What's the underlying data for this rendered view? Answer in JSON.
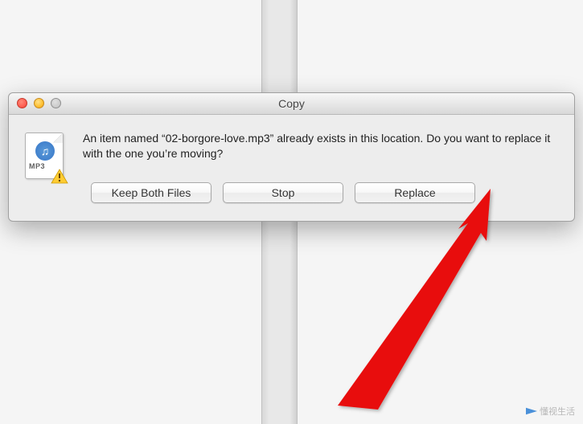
{
  "dialog": {
    "title": "Copy",
    "message": "An item named “02-borgore-love.mp3” already exists in this location. Do you want to replace it with the one you’re moving?",
    "file_type_label": "MP3",
    "buttons": {
      "keep_both": "Keep Both Files",
      "stop": "Stop",
      "replace": "Replace"
    }
  },
  "watermark": {
    "text": "懂视生活"
  }
}
